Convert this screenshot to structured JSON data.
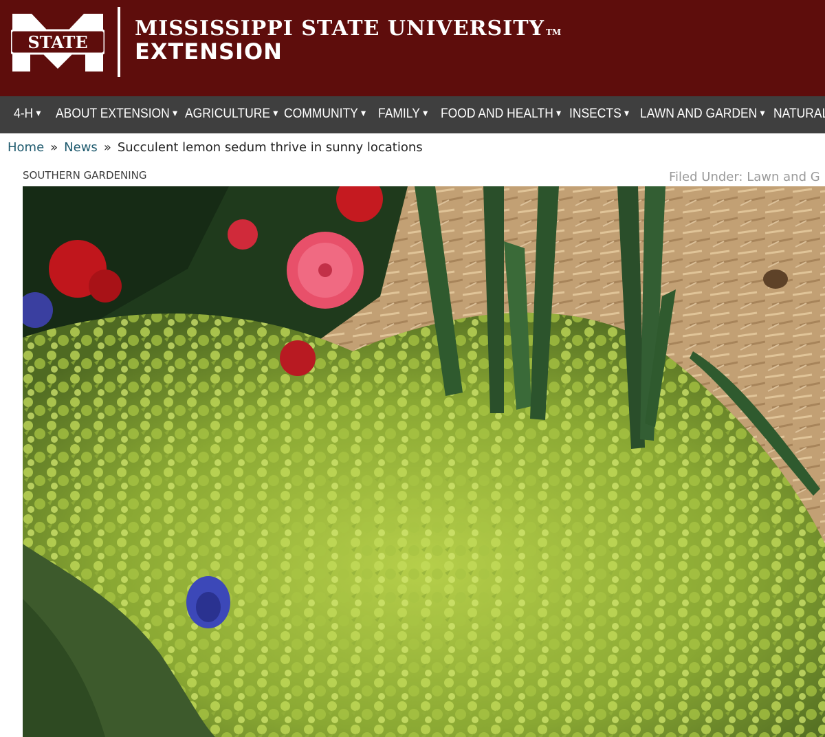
{
  "header": {
    "logo_text": "STATE",
    "title_line1": "MISSISSIPPI STATE UNIVERSITY",
    "title_tm": "TM",
    "title_line2": "EXTENSION",
    "colors": {
      "maroon": "#5e0d0c",
      "nav": "#3f3f3f"
    }
  },
  "nav": {
    "caret_icon": "caret-down-icon",
    "items": [
      {
        "label": "4-H"
      },
      {
        "label": "ABOUT EXTENSION"
      },
      {
        "label": "AGRICULTURE"
      },
      {
        "label": "COMMUNITY"
      },
      {
        "label": "FAMILY"
      },
      {
        "label": "FOOD AND HEALTH"
      },
      {
        "label": "INSECTS"
      },
      {
        "label": "LAWN AND GARDEN"
      },
      {
        "label": "NATURAL"
      }
    ]
  },
  "breadcrumb": {
    "home": "Home",
    "news": "News",
    "separator": "»",
    "current": "Succulent lemon sedum thrive in sunny locations"
  },
  "article": {
    "category": "SOUTHERN GARDENING",
    "filed_under": "Filed Under: Lawn and G"
  }
}
